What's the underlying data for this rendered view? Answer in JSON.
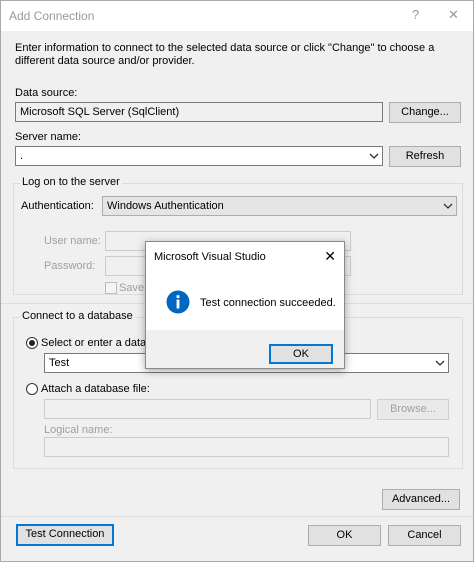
{
  "window": {
    "title": "Add Connection",
    "help_glyph": "?",
    "close_glyph": "✕"
  },
  "description": "Enter information to connect to the selected data source or click \"Change\" to choose a different data source and/or provider.",
  "data_source": {
    "label": "Data source:",
    "value": "Microsoft SQL Server (SqlClient)",
    "change_button": "Change..."
  },
  "server": {
    "label": "Server name:",
    "value": ".",
    "refresh_button": "Refresh"
  },
  "logon": {
    "group_title": "Log on to the server",
    "auth_label": "Authentication:",
    "auth_value": "Windows Authentication",
    "user_label": "User name:",
    "password_label": "Password:",
    "save_password_label": "Save m"
  },
  "database": {
    "group_title": "Connect to a database",
    "select_option": "Select or enter a databa",
    "db_value": "Test",
    "attach_option": "Attach a database file:",
    "browse_button": "Browse...",
    "logical_name_label": "Logical name:"
  },
  "buttons": {
    "advanced": "Advanced...",
    "test_connection": "Test Connection",
    "ok": "OK",
    "cancel": "Cancel"
  },
  "modal": {
    "title": "Microsoft Visual Studio",
    "close_glyph": "✕",
    "message": "Test connection succeeded.",
    "ok_button": "OK"
  },
  "colors": {
    "accent": "#0078d7",
    "info_icon": "#0067c0"
  }
}
